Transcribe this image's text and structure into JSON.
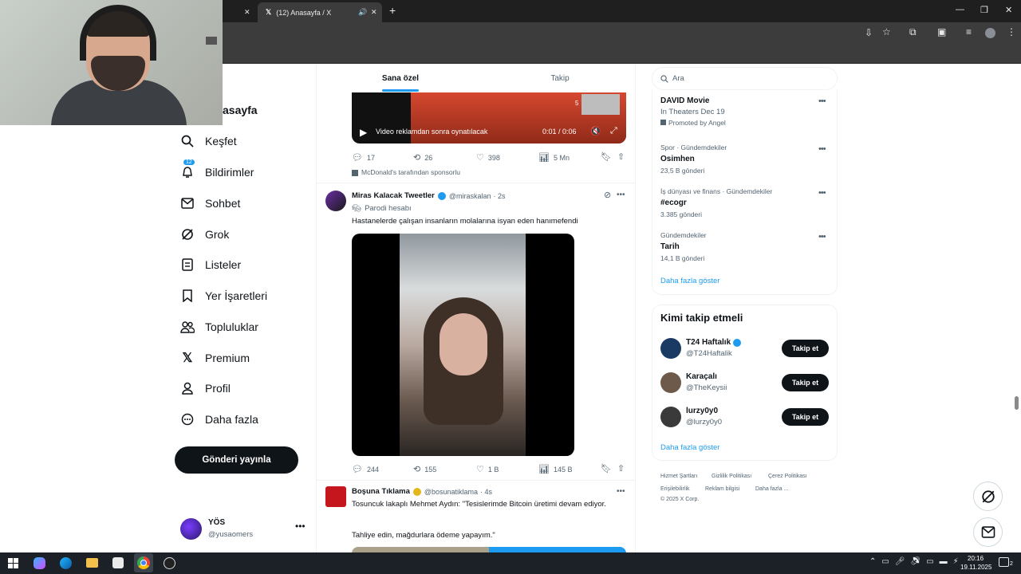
{
  "browser": {
    "tab_title": "(12) Anasayfa / X",
    "new_tab": "+",
    "close": "✕",
    "minimize": "—",
    "restore": "❐"
  },
  "sidebar": {
    "home_partial": "asayfa",
    "items": [
      {
        "label": "Keşfet",
        "icon": "search-icon"
      },
      {
        "label": "Bildirimler",
        "icon": "bell-icon",
        "badge": "12"
      },
      {
        "label": "Sohbet",
        "icon": "mail-icon"
      },
      {
        "label": "Grok",
        "icon": "grok-icon"
      },
      {
        "label": "Listeler",
        "icon": "list-icon"
      },
      {
        "label": "Yer İşaretleri",
        "icon": "bookmark-icon"
      },
      {
        "label": "Topluluklar",
        "icon": "community-icon"
      },
      {
        "label": "Premium",
        "icon": "x-logo-icon"
      },
      {
        "label": "Profil",
        "icon": "profile-icon"
      },
      {
        "label": "Daha fazla",
        "icon": "more-circle-icon"
      }
    ],
    "post_button": "Gönderi yayınla",
    "user": {
      "name": "YÖS",
      "handle": "@yusaomers"
    }
  },
  "feed": {
    "tabs": [
      "Sana özel",
      "Takip"
    ],
    "ad_post": {
      "video_text": "Video reklamdan sonra oynatılacak",
      "time": "0:01 / 0:06",
      "thumb_count": "5",
      "replies": "17",
      "reposts": "26",
      "likes": "398",
      "views": "5 Mn",
      "sponsor": "McDonald's tarafından sponsorlu"
    },
    "post1": {
      "name": "Miras Kalacak Tweetler",
      "handle": "@miraskalan",
      "time": "· 2s",
      "parody": "Parodi hesabı",
      "text": "Hastanelerde çalışan insanların molalarına isyan eden hanımefendi",
      "replies": "244",
      "reposts": "155",
      "likes": "1 B",
      "views": "145 B"
    },
    "post2": {
      "name": "Boşuna Tıklama",
      "handle": "@bosunatiklama",
      "time": "· 4s",
      "text1": "Tosuncuk lakaplı Mehmet Aydın: \"Tesislerimde Bitcoin üretimi devam ediyor.",
      "text2": "Tahliye edin, mağdurlara ödeme yapayım.\""
    }
  },
  "right": {
    "search_placeholder": "Ara",
    "promo": {
      "title": "DAVID Movie",
      "subtitle": "In Theaters Dec 19",
      "promoted": "Promoted by Angel"
    },
    "trends": [
      {
        "context": "Spor · Gündemdekiler",
        "title": "Osimhen",
        "count": "23,5 B gönderi"
      },
      {
        "context": "İş dünyası ve finans · Gündemdekiler",
        "title": "#ecogr",
        "count": "3.385 gönderi"
      },
      {
        "context": "Gündemdekiler",
        "title": "Tarih",
        "count": "14,1 B gönderi"
      }
    ],
    "show_more": "Daha fazla göster",
    "who_to_follow": {
      "title": "Kimi takip etmeli",
      "accounts": [
        {
          "name": "T24 Haftalık",
          "handle": "@T24Haftalik",
          "button": "Takip et"
        },
        {
          "name": "Karaçalı",
          "handle": "@TheKeysii",
          "button": "Takip et"
        },
        {
          "name": "lurzy0y0",
          "handle": "@lurzy0y0",
          "button": "Takip et"
        }
      ],
      "show_more": "Daha fazla göster"
    },
    "footer": {
      "links1": [
        "Hizmet Şartları",
        "Gizlilik Politikası",
        "Çerez Politikası"
      ],
      "links2": [
        "Erişilebilirlik",
        "Reklam bilgisi",
        "Daha fazla ..."
      ],
      "copyright": "© 2025 X Corp."
    }
  },
  "taskbar": {
    "time": "20:16",
    "date": "19.11.2025",
    "notif_count": "2"
  },
  "colors": {
    "accent": "#1d9bf0",
    "text": "#0f1419",
    "muted": "#536471",
    "border": "#eff3f4"
  }
}
